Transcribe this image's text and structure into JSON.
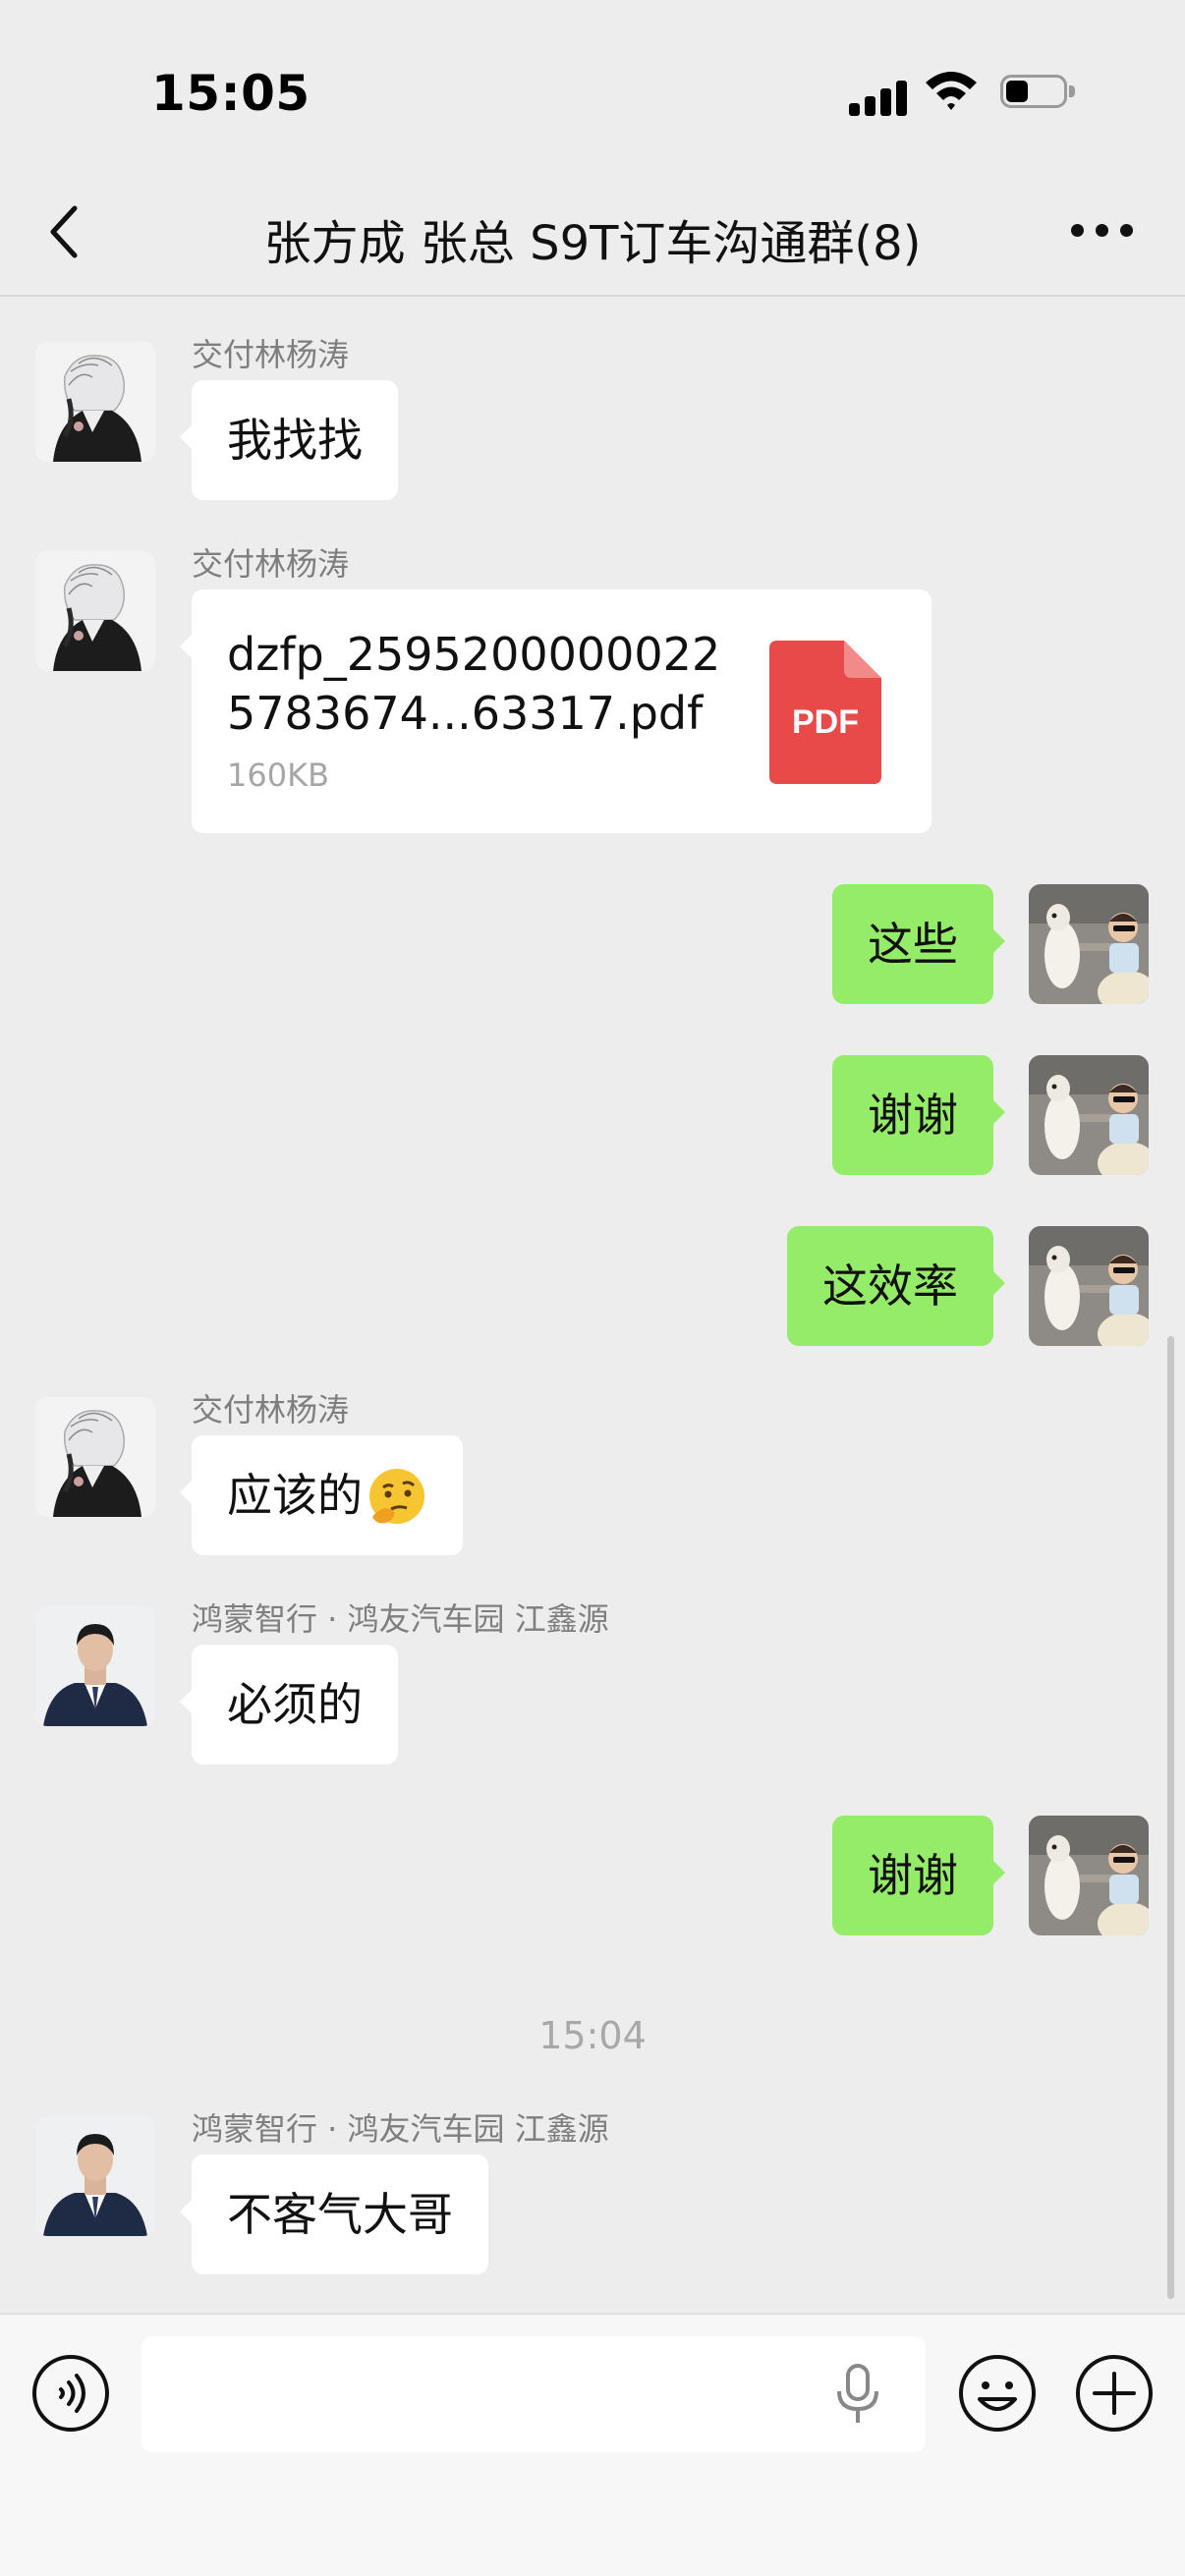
{
  "status_bar": {
    "time": "15:05"
  },
  "header": {
    "title": "张方成 张总 S9T订车沟通群(8)"
  },
  "messages": [
    {
      "sender": "交付林杨涛",
      "text": "我找找"
    },
    {
      "sender": "交付林杨涛",
      "file": {
        "name": "dzfp_25952000000225783674...63317.pdf",
        "size": "160KB",
        "type_label": "PDF"
      }
    },
    {
      "text": "这些"
    },
    {
      "text": "谢谢"
    },
    {
      "text": "这效率"
    },
    {
      "sender": "交付林杨涛",
      "text": "应该的",
      "emoji": "thinking-emoji"
    },
    {
      "sender": "鸿蒙智行 · 鸿友汽车园 江鑫源",
      "text": "必须的"
    },
    {
      "text": "谢谢"
    },
    {
      "sender": "鸿蒙智行 · 鸿友汽车园 江鑫源",
      "text": "不客气大哥"
    }
  ],
  "timestamp": "15:04",
  "colors": {
    "background": "#ededed",
    "self_bubble": "#95ec69",
    "other_bubble": "#ffffff",
    "pdf": "#e84a4a"
  },
  "icons": [
    "back-icon",
    "more-icon",
    "voice-icon",
    "microphone-icon",
    "emoji-icon",
    "plus-icon",
    "pdf-file-icon"
  ]
}
